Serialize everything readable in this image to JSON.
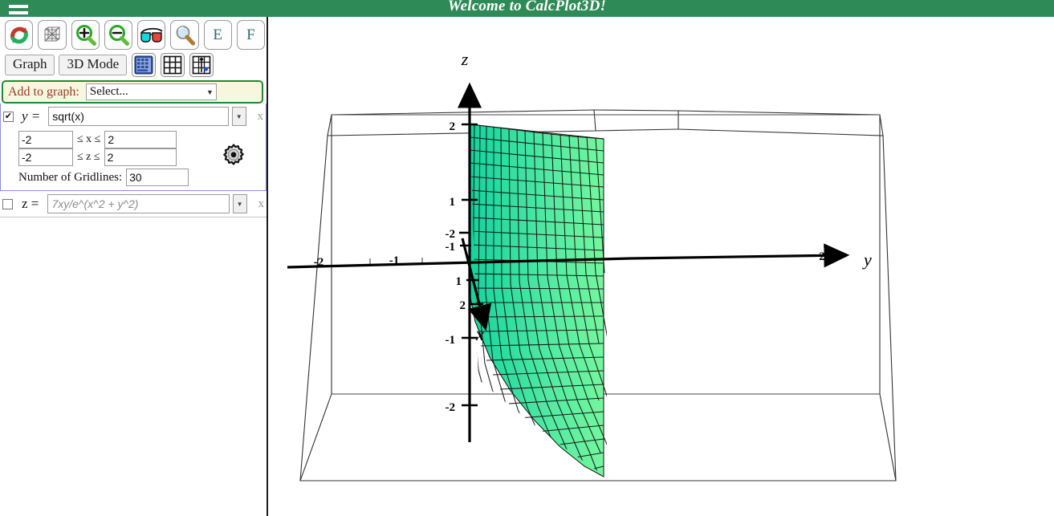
{
  "window": {
    "title": "Welcome to CalcPlot3D!",
    "menu_icon": "hamburger-menu-icon",
    "header_color": "#2e8b57"
  },
  "toolbar": {
    "buttons": [
      {
        "name": "rotate-reset-icon",
        "label": "",
        "icon": "rotate-arrows-icon"
      },
      {
        "name": "wireframe-icon",
        "label": "",
        "icon": "cube-wireframe-icon"
      },
      {
        "name": "zoom-in-icon",
        "label": "",
        "icon": "magnifier-plus-icon"
      },
      {
        "name": "zoom-out-icon",
        "label": "",
        "icon": "magnifier-minus-icon"
      },
      {
        "name": "anaglyph-icon",
        "label": "",
        "icon": "3d-glasses-icon"
      },
      {
        "name": "zoom-tool-icon",
        "label": "",
        "icon": "magnifier-icon"
      },
      {
        "name": "e-button",
        "label": "E",
        "icon": "letter-e"
      },
      {
        "name": "f-button",
        "label": "F",
        "icon": "letter-f"
      }
    ]
  },
  "modebar": {
    "graph_label": "Graph",
    "mode_label": "3D Mode",
    "grid_buttons": [
      {
        "name": "keypad-icon"
      },
      {
        "name": "grid-icon"
      },
      {
        "name": "grid-axes-point-icon"
      }
    ]
  },
  "add_to_graph": {
    "label": "Add to graph:",
    "selected": "Select...",
    "caret": "▼",
    "label_color": "#9c3a24",
    "border_color": "#1d8b2f",
    "background_color": "#f7f7e0"
  },
  "functions": [
    {
      "enabled": true,
      "checkmark": "✔",
      "var_label": "y =",
      "value": "sqrt(x)",
      "caret": "▼",
      "close_label": "x",
      "ranges": {
        "x_min": "-2",
        "x_sym": "≤ x ≤",
        "x_max": "2",
        "z_min": "-2",
        "z_sym": "≤ z ≤",
        "z_max": "2"
      },
      "gridlines_label": "Number of Gridlines:",
      "gridlines_value": "30",
      "settings_icon": "gear-icon"
    },
    {
      "enabled": false,
      "checkmark": "",
      "var_label": "z =",
      "value": "7xy/e^(x^2 + y^2)",
      "caret": "▼",
      "close_label": "x"
    }
  ],
  "plot": {
    "surface_color_near": "#1fd9a2",
    "surface_color_far": "#6df39b",
    "mesh_color": "#111111",
    "box_color": "#333333",
    "axes": [
      {
        "name": "x",
        "label": "x",
        "ticks": [
          "-2",
          "-1",
          "1",
          "2"
        ]
      },
      {
        "name": "y",
        "label": "y",
        "ticks": [
          "-2",
          "-1",
          "2"
        ]
      },
      {
        "name": "z",
        "label": "z",
        "ticks": [
          "2",
          "1",
          "-1",
          "-2"
        ]
      }
    ],
    "axis_label_x": "x",
    "axis_label_y": "y",
    "axis_label_z": "z",
    "z_tick_2": "2",
    "z_tick_1": "1",
    "z_tick_m1": "-1",
    "z_tick_m2": "-2",
    "y_tick_m2": "-2",
    "y_tick_m1": "-1",
    "y_tick_2": "2",
    "x_tick_m2": "-2",
    "x_tick_m1": "-1",
    "x_tick_1": "1",
    "x_tick_2": "2"
  }
}
